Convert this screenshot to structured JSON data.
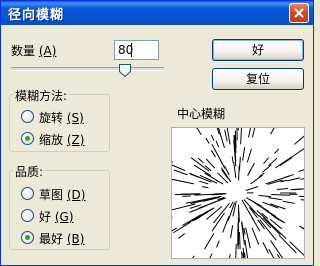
{
  "title": "径向模糊",
  "amount": {
    "label": "数量",
    "hotkey": "(A)",
    "value": "80",
    "max": 100
  },
  "buttons": {
    "ok": "好",
    "reset": "复位"
  },
  "blur_method": {
    "title": "模糊方法:",
    "options": [
      {
        "label": "旋转",
        "hotkey": "(S)",
        "checked": false
      },
      {
        "label": "缩放",
        "hotkey": "(Z)",
        "checked": true
      }
    ]
  },
  "quality": {
    "title": "品质:",
    "options": [
      {
        "label": "草图",
        "hotkey": "(D)",
        "checked": false
      },
      {
        "label": "好",
        "hotkey": "(G)",
        "checked": false
      },
      {
        "label": "最好",
        "hotkey": "(B)",
        "checked": true
      }
    ]
  },
  "center": {
    "title": "中心模糊"
  },
  "icons": {
    "close": "close-icon",
    "slider": "slider-thumb-icon"
  }
}
